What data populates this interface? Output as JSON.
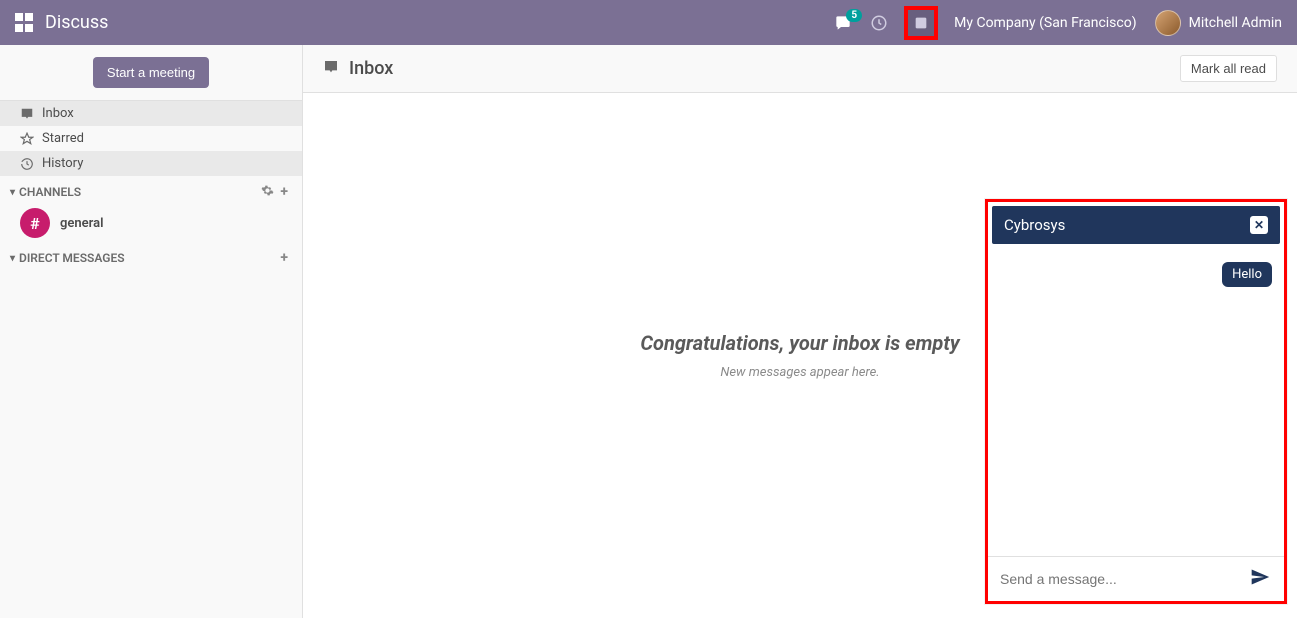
{
  "topbar": {
    "title": "Discuss",
    "message_badge": "5",
    "company": "My Company (San Francisco)",
    "user": "Mitchell Admin"
  },
  "sidebar": {
    "start_meeting": "Start a meeting",
    "nav": [
      {
        "icon": "inbox-icon",
        "label": "Inbox",
        "active": true
      },
      {
        "icon": "star-icon",
        "label": "Starred",
        "active": false
      },
      {
        "icon": "history-icon",
        "label": "History",
        "active": false
      }
    ],
    "channels_header": "CHANNELS",
    "channels": [
      {
        "symbol": "#",
        "name": "general"
      }
    ],
    "dm_header": "DIRECT MESSAGES"
  },
  "main": {
    "title": "Inbox",
    "mark_all_read": "Mark all read",
    "empty_heading": "Congratulations, your inbox is empty",
    "empty_sub": "New messages appear here."
  },
  "chat": {
    "title": "Cybrosys",
    "messages": [
      {
        "text": "Hello",
        "mine": true
      }
    ],
    "placeholder": "Send a message..."
  },
  "colors": {
    "brand": "#7b7094",
    "chat_dark": "#20365c",
    "teal": "#00a09d",
    "highlight": "#ff0000"
  }
}
